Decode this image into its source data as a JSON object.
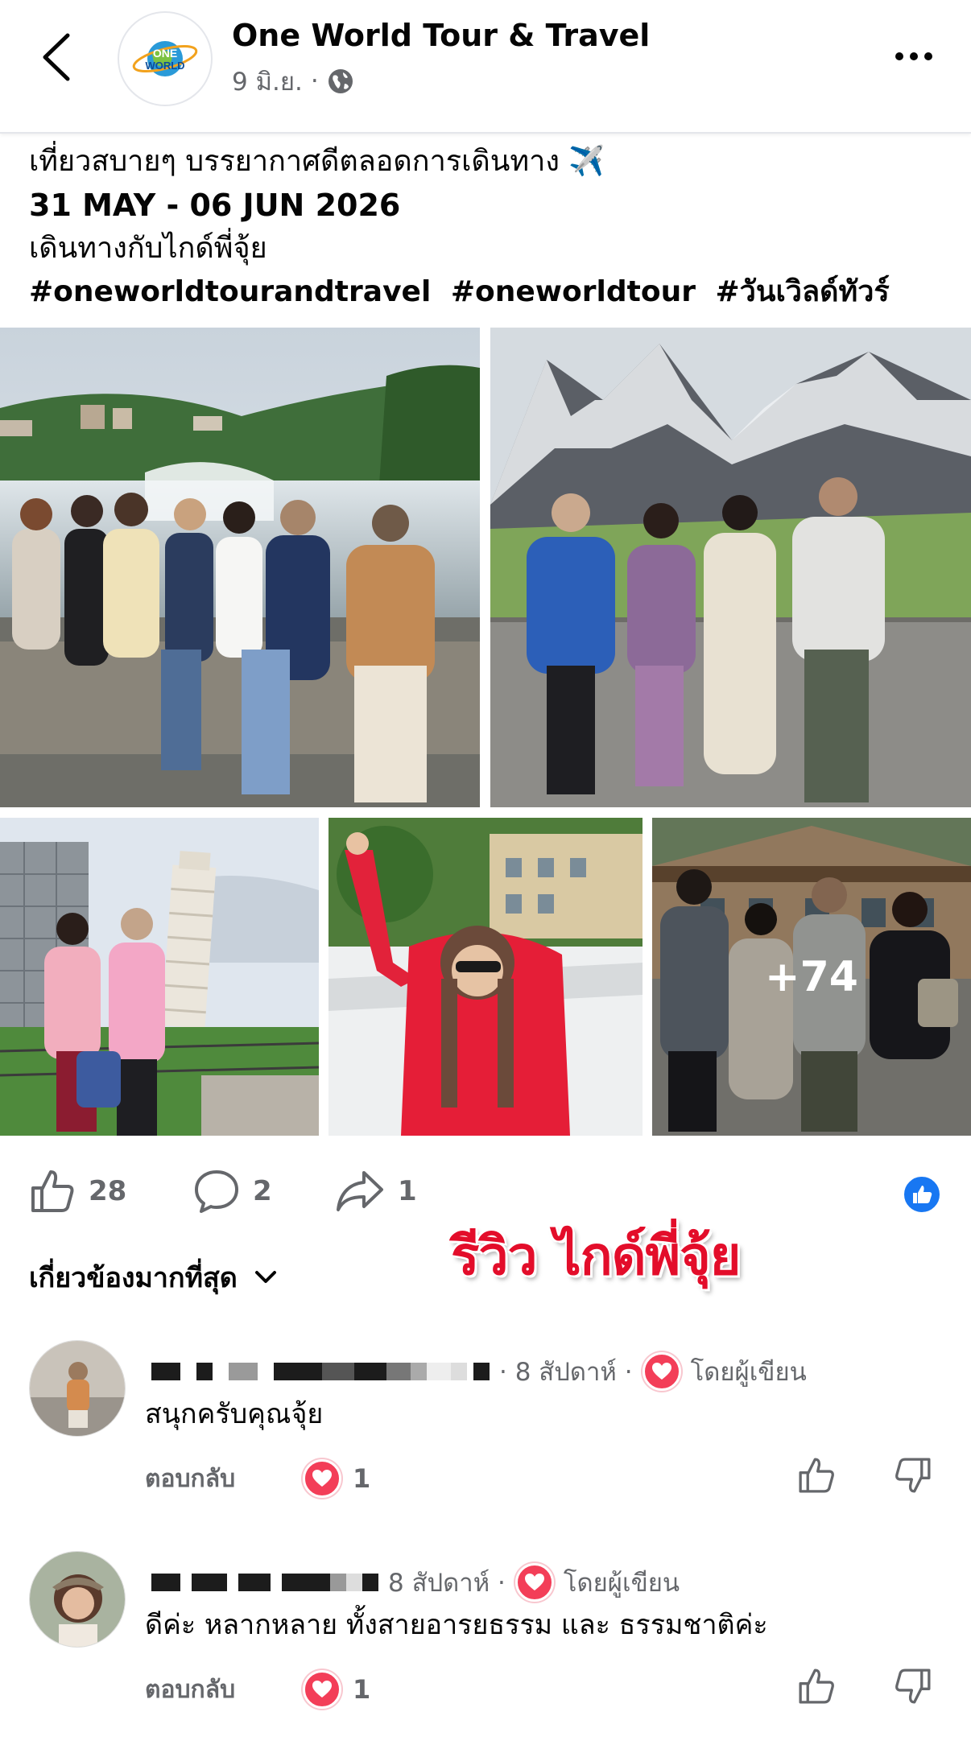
{
  "header": {
    "page_name": "One World Tour & Travel",
    "date": "9 มิ.ย.",
    "separator": "·",
    "logo_text_top": "ONE",
    "logo_text_bottom": "WORLD"
  },
  "post": {
    "line1": "เที่ยวสบายๆ บรรยากาศดีตลอดการเดินทาง ✈️",
    "line2": "31 MAY - 06 JUN 2026",
    "line3": "เดินทางกับไกด์พี่จุ้ย",
    "hashtags": [
      "#oneworldtourandtravel",
      "#oneworldtour",
      "#วันเวิลด์ทัวร์"
    ]
  },
  "photos": {
    "more_count": "+74"
  },
  "actions": {
    "likes": "28",
    "comments": "2",
    "shares": "1"
  },
  "review_banner": "รีวิว ไกด์พี่จุ้ย",
  "sort_label": "เกี่ยวข้องมากที่สุด",
  "comments": [
    {
      "time": "· 8 สัปดาห์ ·",
      "author_badge": "โดยผู้เขียน",
      "text": "สนุกครับคุณจุ้ย",
      "reply_label": "ตอบกลับ",
      "reaction_count": "1"
    },
    {
      "time": "8 สัปดาห์ ·",
      "author_badge": "โดยผู้เขียน",
      "text": "ดีค่ะ หลากหลาย ทั้งสายอารยธรรม และ ธรรมชาติค่ะ",
      "reply_label": "ตอบกลับ",
      "reaction_count": "1"
    }
  ],
  "colors": {
    "facebook_blue": "#1877f2",
    "hashtag_blue": "#1b5fc1",
    "love_red": "#f33e58",
    "banner_red": "#e30d2a",
    "meta_gray": "#65676b"
  }
}
